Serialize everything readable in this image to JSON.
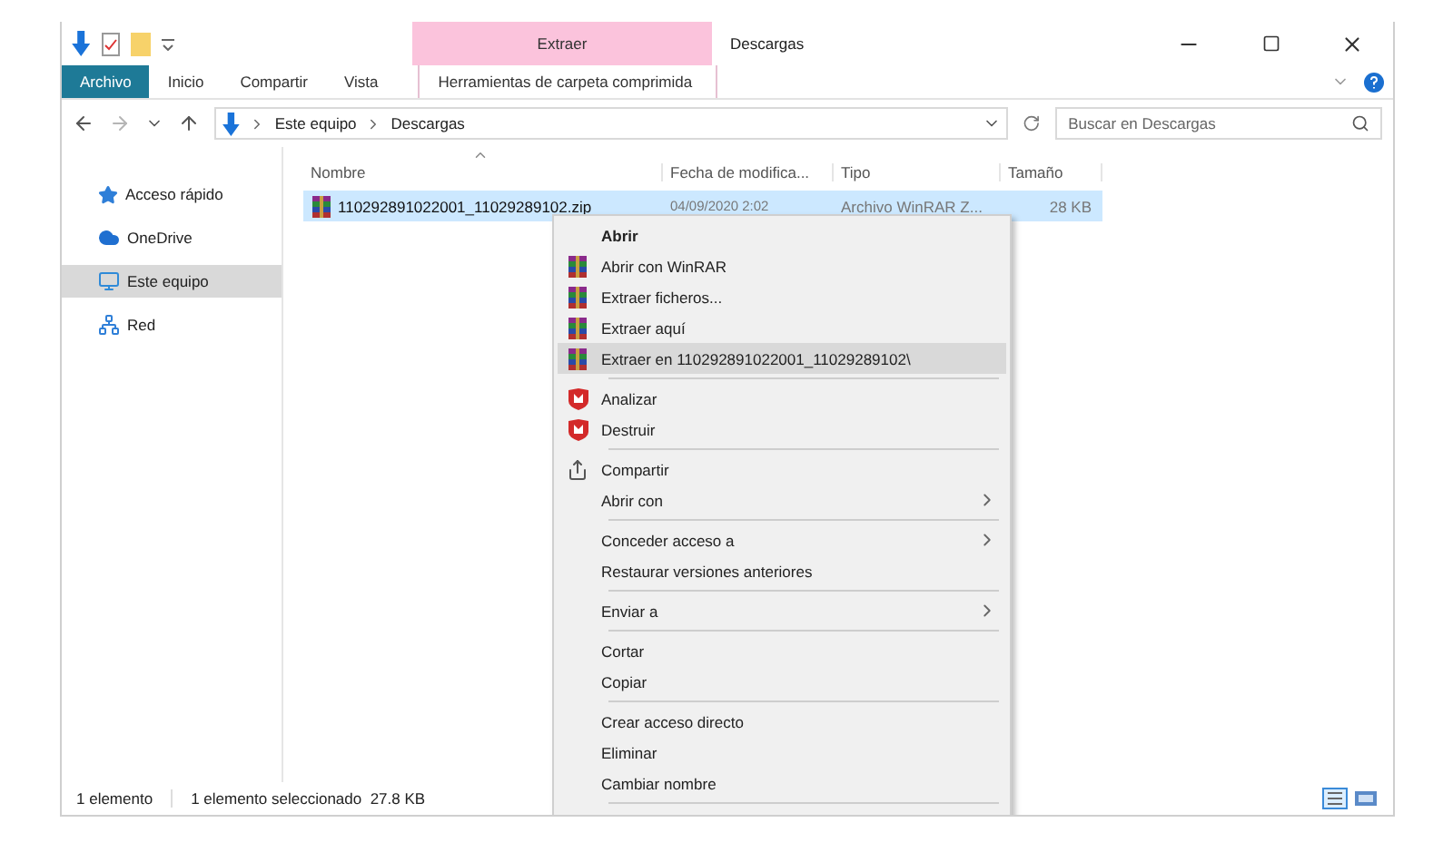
{
  "window": {
    "title": "Descargas",
    "contextual_group": "Extraer"
  },
  "ribbon_tabs": [
    {
      "label": "Archivo",
      "kind": "file",
      "selected": false
    },
    {
      "label": "Inicio",
      "kind": "tab",
      "selected": false
    },
    {
      "label": "Compartir",
      "kind": "tab",
      "selected": false
    },
    {
      "label": "Vista",
      "kind": "tab",
      "selected": false
    },
    {
      "label": "Herramientas de carpeta comprimida",
      "kind": "contextual",
      "selected": false
    }
  ],
  "address": {
    "crumbs": [
      "Este equipo",
      "Descargas"
    ]
  },
  "search": {
    "placeholder": "Buscar en Descargas"
  },
  "sidebar": {
    "items": [
      {
        "label": "Acceso rápido",
        "kind": "star",
        "selected": false
      },
      {
        "label": "OneDrive",
        "kind": "cloud",
        "selected": false
      },
      {
        "label": "Este equipo",
        "kind": "pc",
        "selected": true
      },
      {
        "label": "Red",
        "kind": "network",
        "selected": false
      }
    ]
  },
  "table": {
    "columns": [
      "Nombre",
      "Fecha de modifica...",
      "Tipo",
      "Tamaño"
    ],
    "rows": [
      {
        "cells": [
          "110292891022001_11029289102.zip",
          "04/09/2020 2:02",
          "Archivo WinRAR Z...",
          "28 KB"
        ],
        "selected": true
      }
    ]
  },
  "context_menu": {
    "sections": [
      [
        {
          "label": "Abrir",
          "kind": "plain",
          "default": true,
          "submenu": false,
          "selected": false
        },
        {
          "label": "Abrir con WinRAR",
          "kind": "winrar",
          "default": false,
          "submenu": false,
          "selected": false
        },
        {
          "label": "Extraer ficheros...",
          "kind": "winrar",
          "default": false,
          "submenu": false,
          "selected": false
        },
        {
          "label": "Extraer aquí",
          "kind": "winrar",
          "default": false,
          "submenu": false,
          "selected": false
        },
        {
          "label": "Extraer en 110292891022001_11029289102\\",
          "kind": "winrar",
          "default": false,
          "submenu": false,
          "selected": true
        }
      ],
      [
        {
          "label": "Analizar",
          "kind": "shield",
          "default": false,
          "submenu": false,
          "selected": false
        },
        {
          "label": "Destruir",
          "kind": "shield",
          "default": false,
          "submenu": false,
          "selected": false
        }
      ],
      [
        {
          "label": "Compartir",
          "kind": "share",
          "default": false,
          "submenu": false,
          "selected": false
        },
        {
          "label": "Abrir con",
          "kind": "plain",
          "default": false,
          "submenu": true,
          "selected": false
        }
      ],
      [
        {
          "label": "Conceder acceso a",
          "kind": "plain",
          "default": false,
          "submenu": true,
          "selected": false
        },
        {
          "label": "Restaurar versiones anteriores",
          "kind": "plain",
          "default": false,
          "submenu": false,
          "selected": false
        }
      ],
      [
        {
          "label": "Enviar a",
          "kind": "plain",
          "default": false,
          "submenu": true,
          "selected": false
        }
      ],
      [
        {
          "label": "Cortar",
          "kind": "plain",
          "default": false,
          "submenu": false,
          "selected": false
        },
        {
          "label": "Copiar",
          "kind": "plain",
          "default": false,
          "submenu": false,
          "selected": false
        }
      ],
      [
        {
          "label": "Crear acceso directo",
          "kind": "plain",
          "default": false,
          "submenu": false,
          "selected": false
        },
        {
          "label": "Eliminar",
          "kind": "plain",
          "default": false,
          "submenu": false,
          "selected": false
        },
        {
          "label": "Cambiar nombre",
          "kind": "plain",
          "default": false,
          "submenu": false,
          "selected": false
        }
      ]
    ]
  },
  "status_bar": {
    "count": "1 elemento",
    "selection": "1 elemento seleccionado  27.8 KB"
  }
}
